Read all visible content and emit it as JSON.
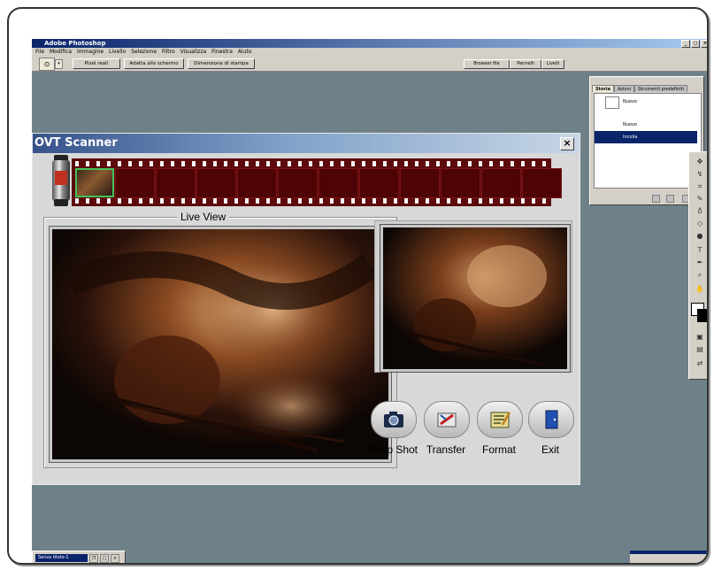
{
  "photoshop": {
    "title": "Adobe Photoshop",
    "menu": [
      "File",
      "Modifica",
      "Immagine",
      "Livello",
      "Selezione",
      "Filtro",
      "Visualizza",
      "Finestra",
      "Aiuto"
    ],
    "options_buttons": [
      "Pixel reali",
      "Adatta allo schermo",
      "Dimensione di stampa"
    ],
    "palette_tabs": [
      "Browser file",
      "Pennelli",
      "Livelli"
    ]
  },
  "history_panel": {
    "tabs": [
      "Storia",
      "Azioni",
      "Strumenti predefiniti"
    ],
    "snapshot": "Nuovo",
    "items": [
      "Nuovo",
      "Incolla"
    ],
    "selected": "Incolla"
  },
  "taskbar": {
    "document": "Senza titolo-1"
  },
  "ovt": {
    "title": "OVT Scanner",
    "close": "×",
    "live_view_label": "Live  View",
    "buttons": [
      {
        "label": "Snap Shot",
        "icon": "camera-icon"
      },
      {
        "label": "Transfer",
        "icon": "transfer-icon"
      },
      {
        "label": "Format",
        "icon": "format-icon"
      },
      {
        "label": "Exit",
        "icon": "exit-door-icon"
      }
    ]
  },
  "colors": {
    "film_strip": "#5d0a0c",
    "titlebar": "#36528a",
    "selected_frame": "#46c058"
  }
}
